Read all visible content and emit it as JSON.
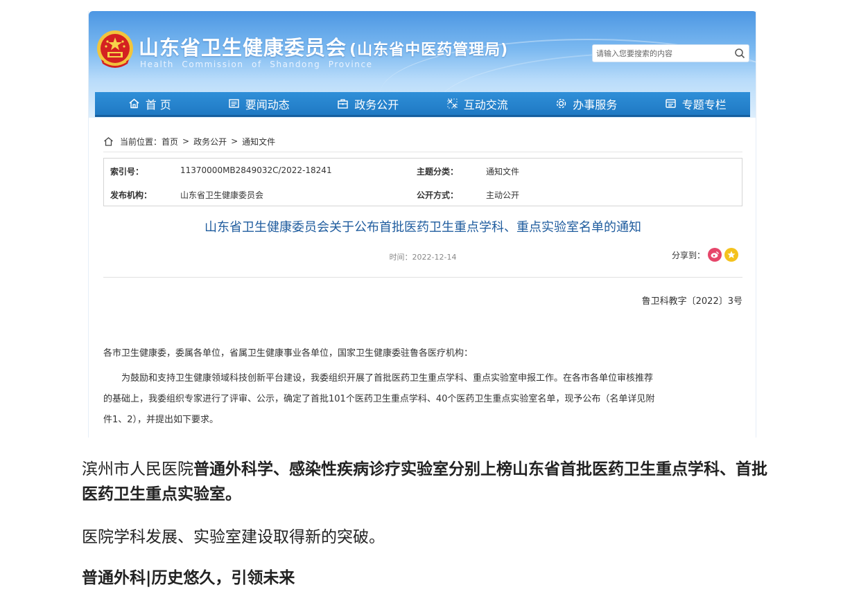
{
  "site": {
    "title": "山东省卫生健康委员会",
    "subtitle": "(山东省中医药管理局)",
    "english": "Health Commission of Shandong Province",
    "search_placeholder": "请输入您要搜索的内容"
  },
  "nav": {
    "items": [
      {
        "label": "首 页",
        "icon": "home-icon"
      },
      {
        "label": "要闻动态",
        "icon": "news-icon"
      },
      {
        "label": "政务公开",
        "icon": "gov-icon"
      },
      {
        "label": "互动交流",
        "icon": "interact-icon"
      },
      {
        "label": "办事服务",
        "icon": "service-icon"
      },
      {
        "label": "专题专栏",
        "icon": "topic-icon"
      }
    ]
  },
  "breadcrumb": {
    "label": "当前位置：",
    "items": [
      "首页",
      "政务公开",
      "通知文件"
    ],
    "separator": ">"
  },
  "meta": {
    "index_label": "索引号：",
    "index_value": "11370000MB2849032C/2022-18241",
    "topic_label": "主题分类：",
    "topic_value": "通知文件",
    "publisher_label": "发布机构：",
    "publisher_value": "山东省卫生健康委员会",
    "disclosure_label": "公开方式：",
    "disclosure_value": "主动公开"
  },
  "doc": {
    "title": "山东省卫生健康委员会关于公布首批医药卫生重点学科、重点实验室名单的通知",
    "time": "时间：2022-12-14",
    "share_label": "分享到：",
    "doc_number": "鲁卫科教字〔2022〕3号",
    "salutation": "各市卫生健康委，委属各单位，省属卫生健康事业各单位，国家卫生健康委驻鲁各医疗机构：",
    "para_line1": "为鼓励和支持卫生健康领域科技创新平台建设，我委组织开展了首批医药卫生重点学科、重点实验室申报工作。在各市各单位审核推荐",
    "para_line2": "的基础上，我委组织专家进行了评审、公示，确定了首批101个医药卫生重点学科、40个医药卫生重点实验室名单，现予公布（名单详见附",
    "para_line3": "件1、2），并提出如下要求。"
  },
  "article": {
    "p1_normal": "滨州市人民医院",
    "p1_bold": "普通外科学、感染性疾病诊疗实验室分别上榜山东省首批医药卫生重点学科、首批医药卫生重点实验室。",
    "p2": "医院学科发展、实验室建设取得新的突破。",
    "p3": "普通外科|历史悠久，引领未来"
  }
}
